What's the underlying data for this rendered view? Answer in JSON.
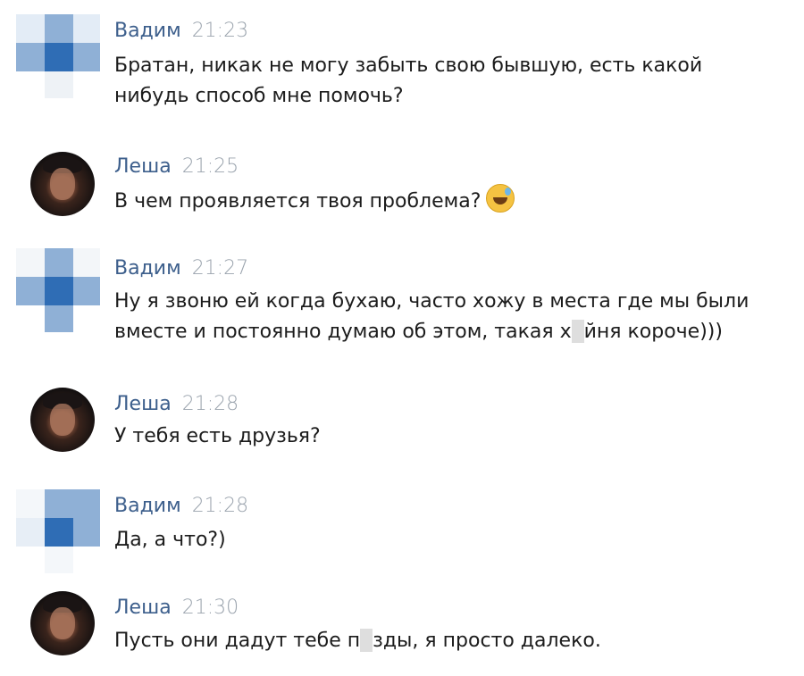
{
  "messages": [
    {
      "author": "Вадим",
      "time": "21:23",
      "text_lines": [
        "Братан, никак не могу забыть свою бывшую, есть какой",
        "нибудь способ мне помочь?"
      ]
    },
    {
      "author": "Леша",
      "time": "21:25",
      "text_lines": [
        "В чем проявляется твоя проблема?"
      ]
    },
    {
      "author": "Вадим",
      "time": "21:27",
      "text_lines": [
        "Ну я звоню ей когда бухаю, часто хожу в места где мы были",
        "вместе и постоянно думаю об этом, такая х",
        "йня короче)))"
      ]
    },
    {
      "author": "Леша",
      "time": "21:28",
      "text_lines": [
        "У тебя есть друзья?"
      ]
    },
    {
      "author": "Вадим",
      "time": "21:28",
      "text_lines": [
        "Да, а что?)"
      ]
    },
    {
      "author": "Леша",
      "time": "21:30",
      "text_lines": [
        "Пусть они дадут тебе п",
        "зды, я просто далеко."
      ]
    }
  ],
  "colors": {
    "name": "#3d5f8c",
    "time": "#9aa3ad",
    "text": "#1c1c1c",
    "identicon_dark": "#2f6db5",
    "identicon_mid": "#8fb0d6",
    "identicon_light": "#e3ecf6"
  },
  "icons": {
    "emoji": "grinning-sweat-emoji",
    "identicon": "identicon-avatar",
    "photo": "user-photo-avatar"
  }
}
